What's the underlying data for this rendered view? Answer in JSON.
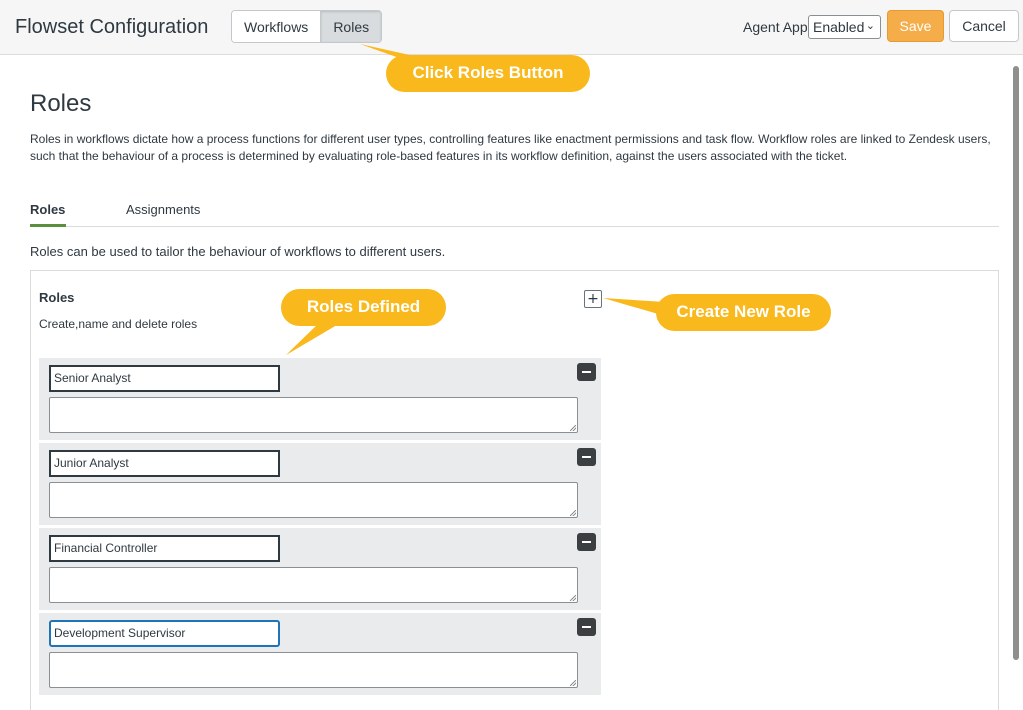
{
  "header": {
    "title": "Flowset Configuration",
    "segments": [
      {
        "label": "Workflows",
        "active": false
      },
      {
        "label": "Roles",
        "active": true
      }
    ],
    "agent_app_label": "Agent App",
    "agent_app_value": "Enabled",
    "save_label": "Save",
    "cancel_label": "Cancel"
  },
  "page": {
    "heading": "Roles",
    "description": "Roles in workflows dictate how a process functions for different user types, controlling features like enactment permissions and task flow. Workflow roles are linked to Zendesk users, such that the behaviour of a process is determined by evaluating role-based features in its workflow definition, against the users associated with the ticket."
  },
  "tabs": [
    {
      "label": "Roles",
      "active": true
    },
    {
      "label": "Assignments",
      "active": false
    }
  ],
  "tabs_description": "Roles can be used to tailor the behaviour of workflows to different users.",
  "panel": {
    "title": "Roles",
    "subtitle": "Create,name and delete roles"
  },
  "roles": [
    {
      "name": "Senior Analyst",
      "description": ""
    },
    {
      "name": "Junior Analyst",
      "description": ""
    },
    {
      "name": "Financial Controller",
      "description": ""
    },
    {
      "name": "Development Supervisor",
      "description": ""
    }
  ],
  "callouts": {
    "roles_button": "Click Roles Button",
    "roles_defined": "Roles Defined",
    "create_role": "Create New Role"
  },
  "colors": {
    "accent": "#f4ad49",
    "callout": "#f9b81b",
    "tab_underline": "#5a8f3e"
  }
}
